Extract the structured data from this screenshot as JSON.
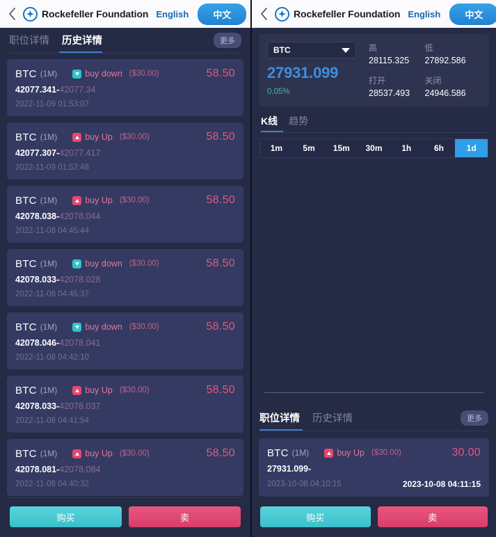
{
  "appbar": {
    "back_icon": "chevron-left-icon",
    "brand_name": "Rockefeller Foundation",
    "lang_en": "English",
    "lang_cn": "中文",
    "menu_icon": "hamburger-menu-icon"
  },
  "left_panel": {
    "tabs": [
      {
        "label": "职位详情",
        "active": false
      },
      {
        "label": "历史详情",
        "active": true
      }
    ],
    "more_label": "更多",
    "records": [
      {
        "symbol": "BTC",
        "period": "(1M)",
        "direction": "buy down",
        "dir_type": "down",
        "amount": "($30.00)",
        "profit": "58.50",
        "open_price": "42077.341",
        "close_price": "42077.34",
        "time": "2022-11-09 01:53:07"
      },
      {
        "symbol": "BTC",
        "period": "(1M)",
        "direction": "buy Up",
        "dir_type": "up",
        "amount": "($30.00)",
        "profit": "58.50",
        "open_price": "42077.307",
        "close_price": "42077.417",
        "time": "2022-11-09 01:52:48"
      },
      {
        "symbol": "BTC",
        "period": "(1M)",
        "direction": "buy Up",
        "dir_type": "up",
        "amount": "($30.00)",
        "profit": "58.50",
        "open_price": "42078.038",
        "close_price": "42078.044",
        "time": "2022-11-08 04:45:44"
      },
      {
        "symbol": "BTC",
        "period": "(1M)",
        "direction": "buy down",
        "dir_type": "down",
        "amount": "($30.00)",
        "profit": "58.50",
        "open_price": "42078.033",
        "close_price": "42078.028",
        "time": "2022-11-08 04:45:37"
      },
      {
        "symbol": "BTC",
        "period": "(1M)",
        "direction": "buy down",
        "dir_type": "down",
        "amount": "($30.00)",
        "profit": "58.50",
        "open_price": "42078.046",
        "close_price": "42078.041",
        "time": "2022-11-08 04:42:10"
      },
      {
        "symbol": "BTC",
        "period": "(1M)",
        "direction": "buy Up",
        "dir_type": "up",
        "amount": "($30.00)",
        "profit": "58.50",
        "open_price": "42078.033",
        "close_price": "42078.037",
        "time": "2022-11-08 04:41:54"
      },
      {
        "symbol": "BTC",
        "period": "(1M)",
        "direction": "buy Up",
        "dir_type": "up",
        "amount": "($30.00)",
        "profit": "58.50",
        "open_price": "42078.081",
        "close_price": "42078.084",
        "time": "2022-11-08 04:40:32"
      }
    ],
    "buy_label": "购买",
    "sell_label": "卖"
  },
  "right_panel": {
    "quote": {
      "symbol": "BTC",
      "price": "27931.099",
      "change_percent": "0.05%",
      "stats": [
        {
          "label": "高",
          "value": "28115.325"
        },
        {
          "label": "低",
          "value": "27892.586"
        },
        {
          "label": "打开",
          "value": "28537.493"
        },
        {
          "label": "关闭",
          "value": "24946.586"
        }
      ]
    },
    "chart_tabs": [
      {
        "label": "K线",
        "active": true
      },
      {
        "label": "趋势",
        "active": false
      }
    ],
    "intervals": [
      {
        "label": "1m",
        "active": false
      },
      {
        "label": "5m",
        "active": false
      },
      {
        "label": "15m",
        "active": false
      },
      {
        "label": "30m",
        "active": false
      },
      {
        "label": "1h",
        "active": false
      },
      {
        "label": "6h",
        "active": false
      },
      {
        "label": "1d",
        "active": true
      }
    ],
    "tabs": [
      {
        "label": "职位详情",
        "active": true
      },
      {
        "label": "历史详情",
        "active": false
      }
    ],
    "more_label": "更多",
    "positions": [
      {
        "symbol": "BTC",
        "period": "(1M)",
        "direction": "buy Up",
        "dir_type": "up",
        "amount": "($30.00)",
        "profit": "30.00",
        "open_price": "27931.099",
        "close_price": "",
        "time_open": "2023-10-08 04:10:15",
        "time_close": "2023-10-08 04:11:15"
      }
    ],
    "buy_label": "购买",
    "sell_label": "卖"
  },
  "chart_data": {
    "type": "line",
    "title": "BTC K线",
    "series": [],
    "x": [],
    "values": [],
    "xlabel": "",
    "ylabel": "",
    "note": "chart viewport rendered empty (no candles drawn)"
  },
  "colors": {
    "panel_bg": "#252a45",
    "card_bg": "#343a62",
    "accent_blue": "#3e8ede",
    "accent_pink": "#e8567f",
    "accent_teal": "#3cbfcb",
    "interval_active": "#2e9fe8"
  }
}
